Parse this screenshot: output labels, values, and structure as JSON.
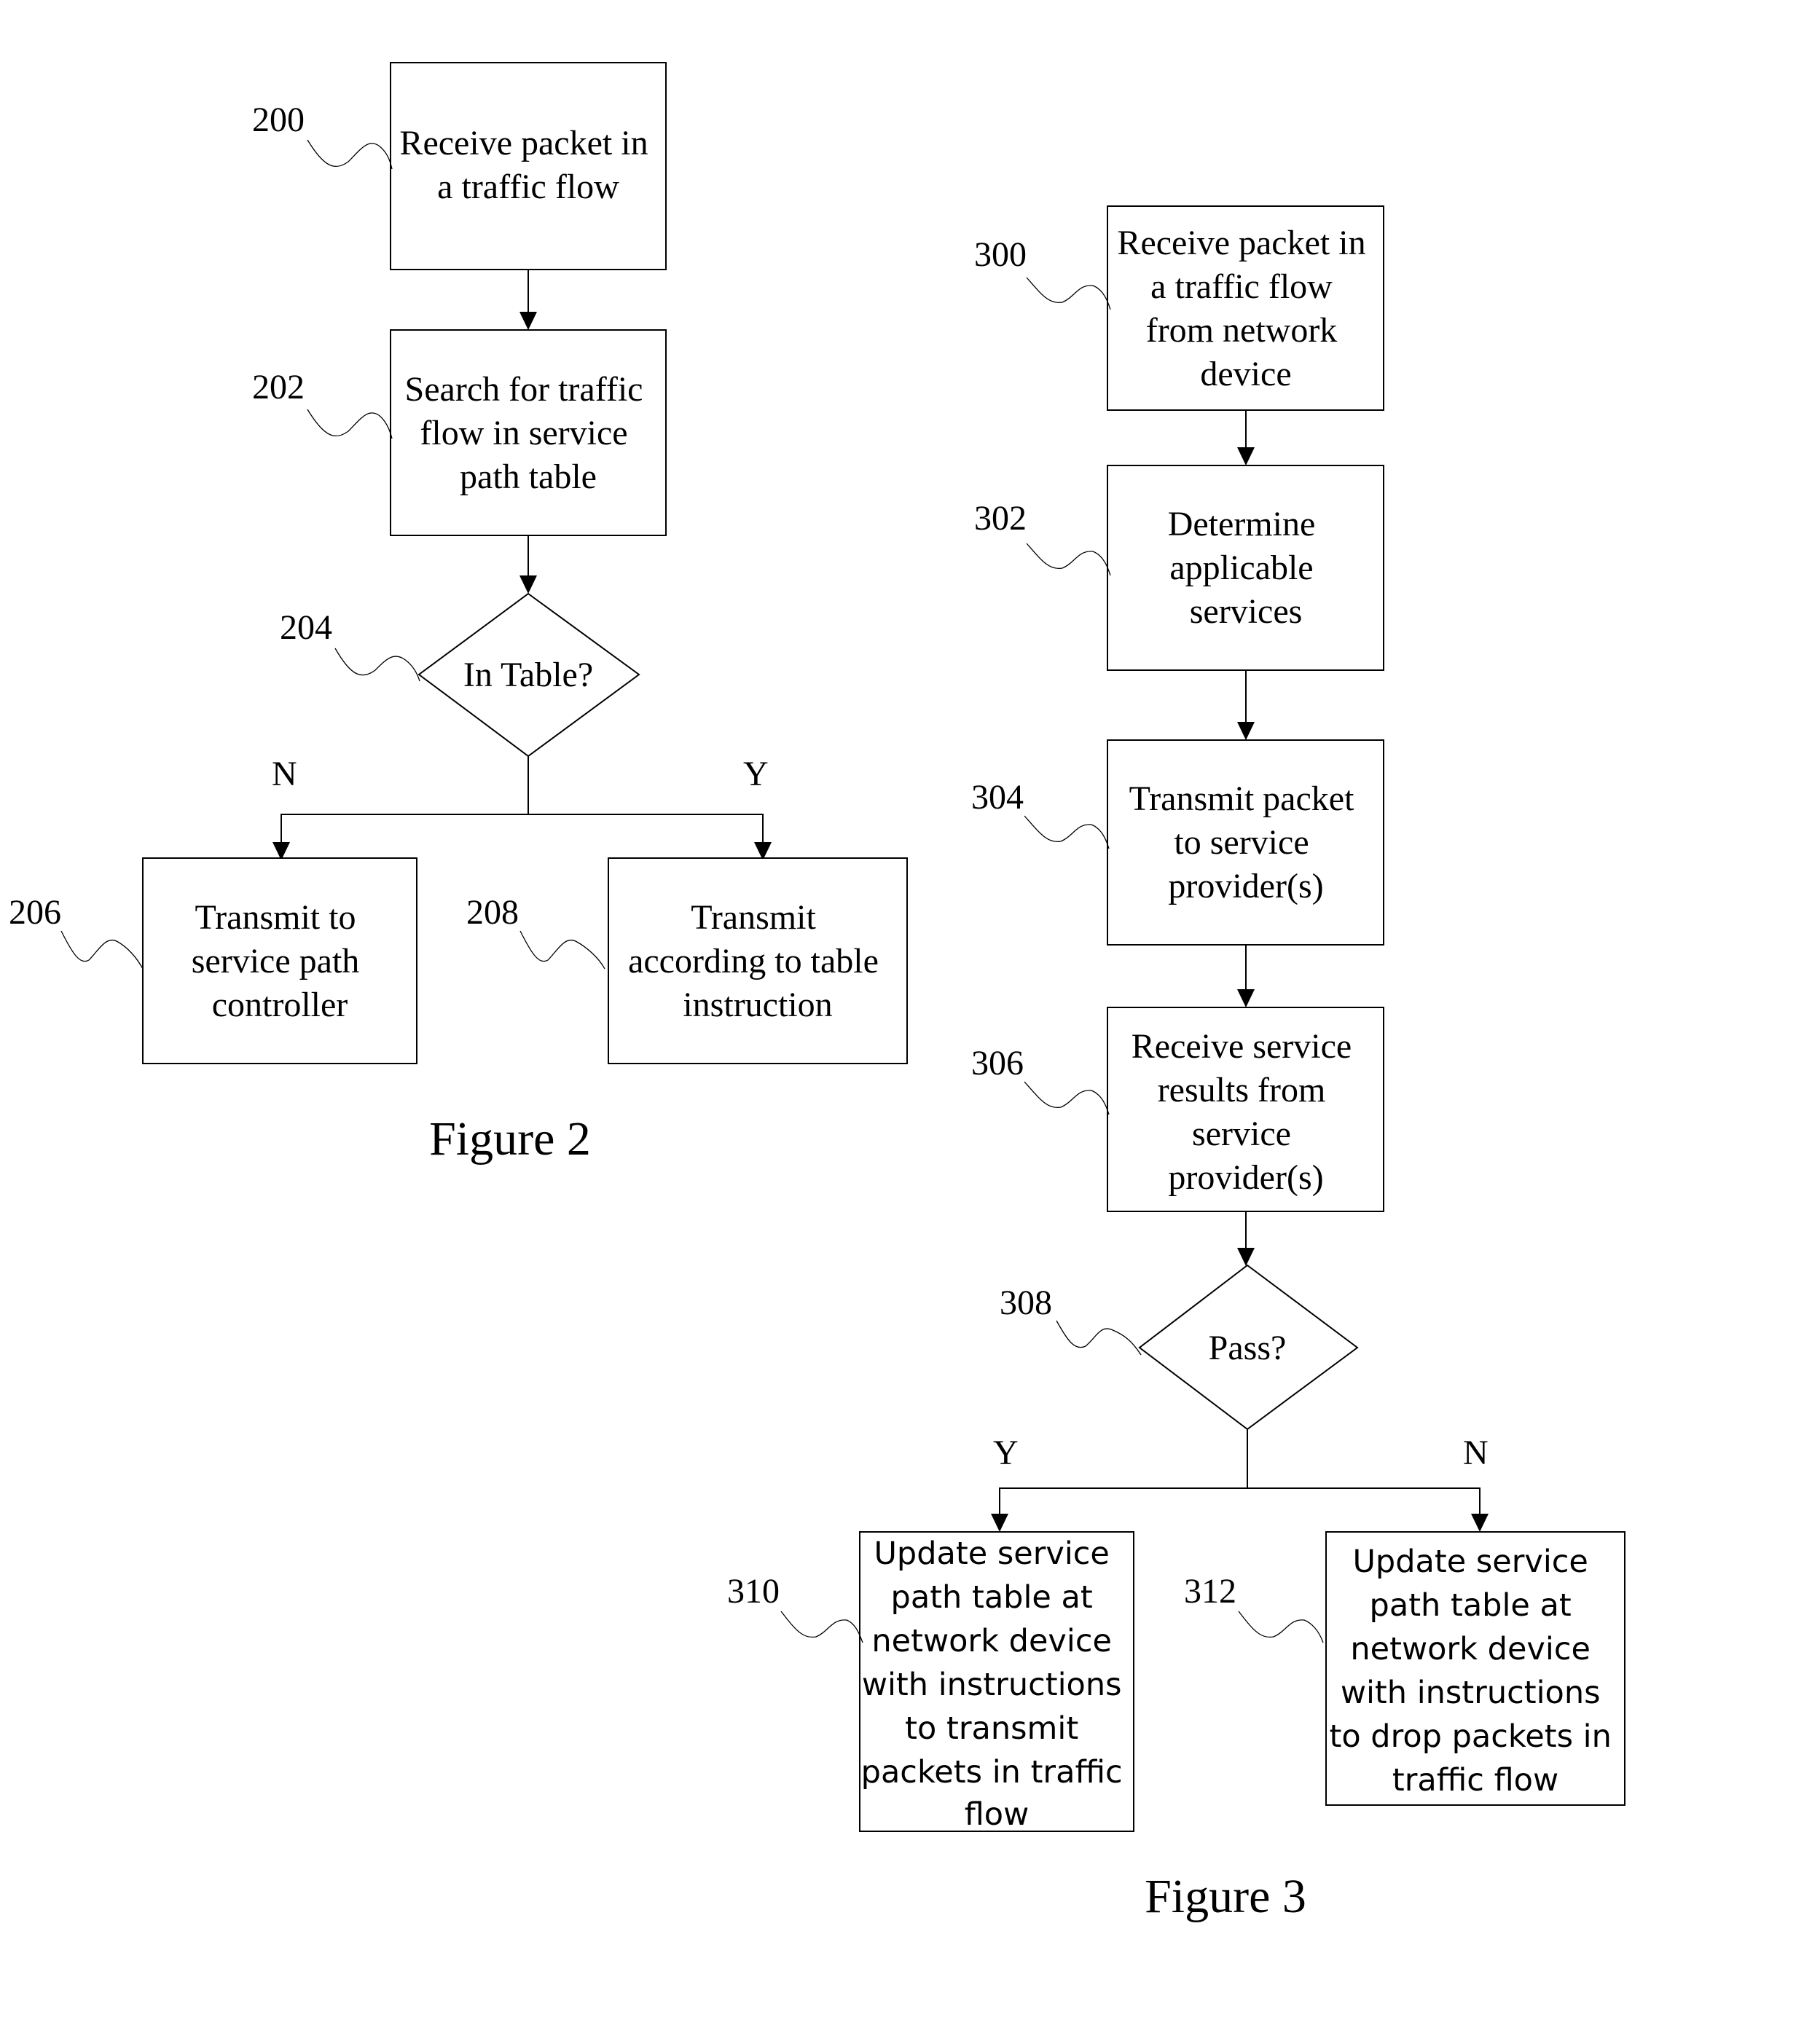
{
  "figure2": {
    "caption": "Figure 2",
    "steps": [
      {
        "ref": "200",
        "type": "process",
        "lines": [
          "Receive packet in",
          "a traffic flow"
        ]
      },
      {
        "ref": "202",
        "type": "process",
        "lines": [
          "Search for traffic",
          "flow in service",
          "path table"
        ]
      },
      {
        "ref": "204",
        "type": "decision",
        "lines": [
          "In Table?"
        ]
      },
      {
        "ref": "206",
        "type": "process",
        "lines": [
          "Transmit to",
          "service path",
          "controller"
        ]
      },
      {
        "ref": "208",
        "type": "process",
        "lines": [
          "Transmit",
          "according to table",
          "instruction"
        ]
      }
    ],
    "branches": {
      "no": "N",
      "yes": "Y"
    }
  },
  "figure3": {
    "caption": "Figure 3",
    "steps": [
      {
        "ref": "300",
        "type": "process",
        "lines": [
          "Receive packet in",
          "a traffic flow",
          "from network",
          "device"
        ]
      },
      {
        "ref": "302",
        "type": "process",
        "lines": [
          "Determine",
          "applicable",
          "services"
        ]
      },
      {
        "ref": "304",
        "type": "process",
        "lines": [
          "Transmit packet",
          "to service",
          "provider(s)"
        ]
      },
      {
        "ref": "306",
        "type": "process",
        "lines": [
          "Receive service",
          "results from",
          "service",
          "provider(s)"
        ]
      },
      {
        "ref": "308",
        "type": "decision",
        "lines": [
          "Pass?"
        ]
      },
      {
        "ref": "310",
        "type": "process",
        "lines": [
          "Update service",
          "path table at",
          "network device",
          "with instructions",
          "to transmit",
          "packets in traffic",
          "flow"
        ]
      },
      {
        "ref": "312",
        "type": "process",
        "lines": [
          "Update service",
          "path table at",
          "network device",
          "with instructions",
          "to drop packets in",
          "traffic flow"
        ]
      }
    ],
    "branches": {
      "yes": "Y",
      "no": "N"
    }
  }
}
